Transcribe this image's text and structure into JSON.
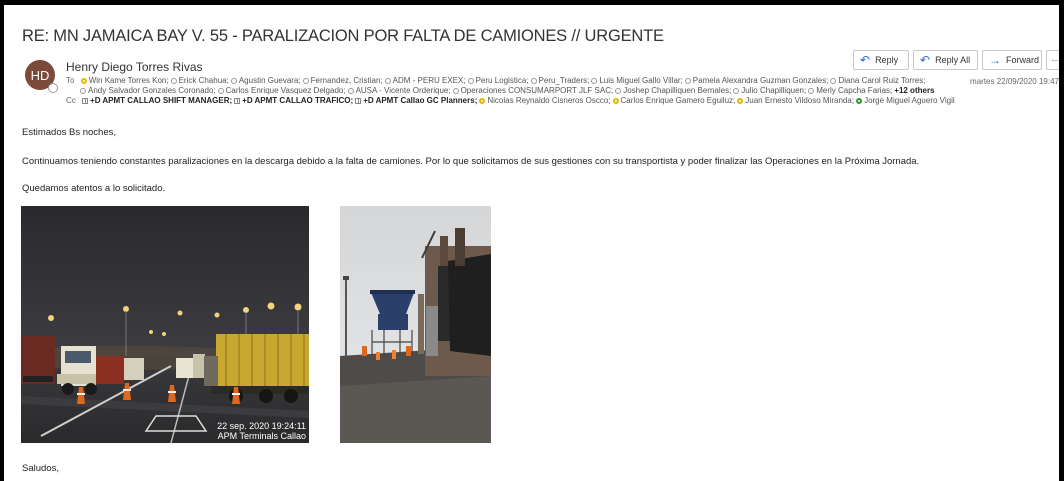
{
  "email": {
    "subject": "RE: MN JAMAICA BAY V. 55 - PARALIZACION POR FALTA DE CAMIONES // URGENTE",
    "avatar_initials": "HD",
    "sender": "Henry Diego Torres Rivas",
    "datetime": "martes 22/09/2020 19:47",
    "to_label": "To",
    "cc_label": "Cc",
    "to_line1": [
      {
        "name": "Win Kame Torres Kon;",
        "status": "yellow"
      },
      {
        "name": "Erick Chahua;",
        "status": "offline"
      },
      {
        "name": "Agustin Guevara;",
        "status": "offline"
      },
      {
        "name": "Fernandez, Cristian;",
        "status": "offline"
      },
      {
        "name": "ADM - PERU EXEX;",
        "status": "offline"
      },
      {
        "name": "Peru Logistica;",
        "status": "offline"
      },
      {
        "name": "Peru_Traders;",
        "status": "offline"
      },
      {
        "name": "Luis Miguel Gallo Villar;",
        "status": "offline"
      },
      {
        "name": "Pamela Alexandra Guzman Gonzales;",
        "status": "offline"
      },
      {
        "name": "Diana Carol Ruiz Torres;",
        "status": "offline"
      }
    ],
    "to_line2": [
      {
        "name": "Andy Salvador Gonzales Coronado;",
        "status": "offline"
      },
      {
        "name": "Carlos Enrique Vasquez Delgado;",
        "status": "offline"
      },
      {
        "name": "AUSA - Vicente Orderique;",
        "status": "offline"
      },
      {
        "name": "Operaciones CONSUMARPORT JLF SAC;",
        "status": "offline"
      },
      {
        "name": "Joshep Chapilliquen Bernales;",
        "status": "offline"
      },
      {
        "name": "Julio Chapilliquen;",
        "status": "offline"
      },
      {
        "name": "Merly Capcha Farias;",
        "status": "offline"
      }
    ],
    "to_more": "+12 others",
    "cc_groups": [
      {
        "name": "+D APMT CALLAO SHIFT MANAGER;"
      },
      {
        "name": "+D APMT CALLAO TRAFICO;"
      },
      {
        "name": "+D APMT Callao GC Planners;"
      }
    ],
    "cc_people": [
      {
        "name": "Nicolas Reynaldo Cisneros Oscco;",
        "status": "yellow"
      },
      {
        "name": "Carlos Enrique Gamero Eguiluz;",
        "status": "yellow"
      },
      {
        "name": "Juan Ernesto Vildoso Miranda;",
        "status": "yellow"
      },
      {
        "name": "Jorge Miguel Aguero Vigil",
        "status": "green"
      }
    ]
  },
  "actions": {
    "reply": "Reply",
    "reply_all": "Reply All",
    "forward": "Forward",
    "more": "···"
  },
  "body": {
    "greeting": "Estimados Bs noches,",
    "paragraph": "Continuamos teniendo constantes paralizaciones en la descarga debido a la falta de camiones. Por lo que solicitamos de sus gestiones con su transportista y poder finalizar las Operaciones en la Próxima Jornada.",
    "closing_request": "Quedamos atentos a lo solicitado.",
    "signoff": "Saludos,"
  },
  "photos": {
    "stamp_line1": "22 sep. 2020 19:24:11",
    "stamp_line2": "APM Terminals Callao"
  },
  "colors": {
    "avatar": "#7b4a39",
    "accent": "#2b6cc4",
    "presence_away": "#e6b800",
    "presence_available": "#2e9a2e"
  }
}
